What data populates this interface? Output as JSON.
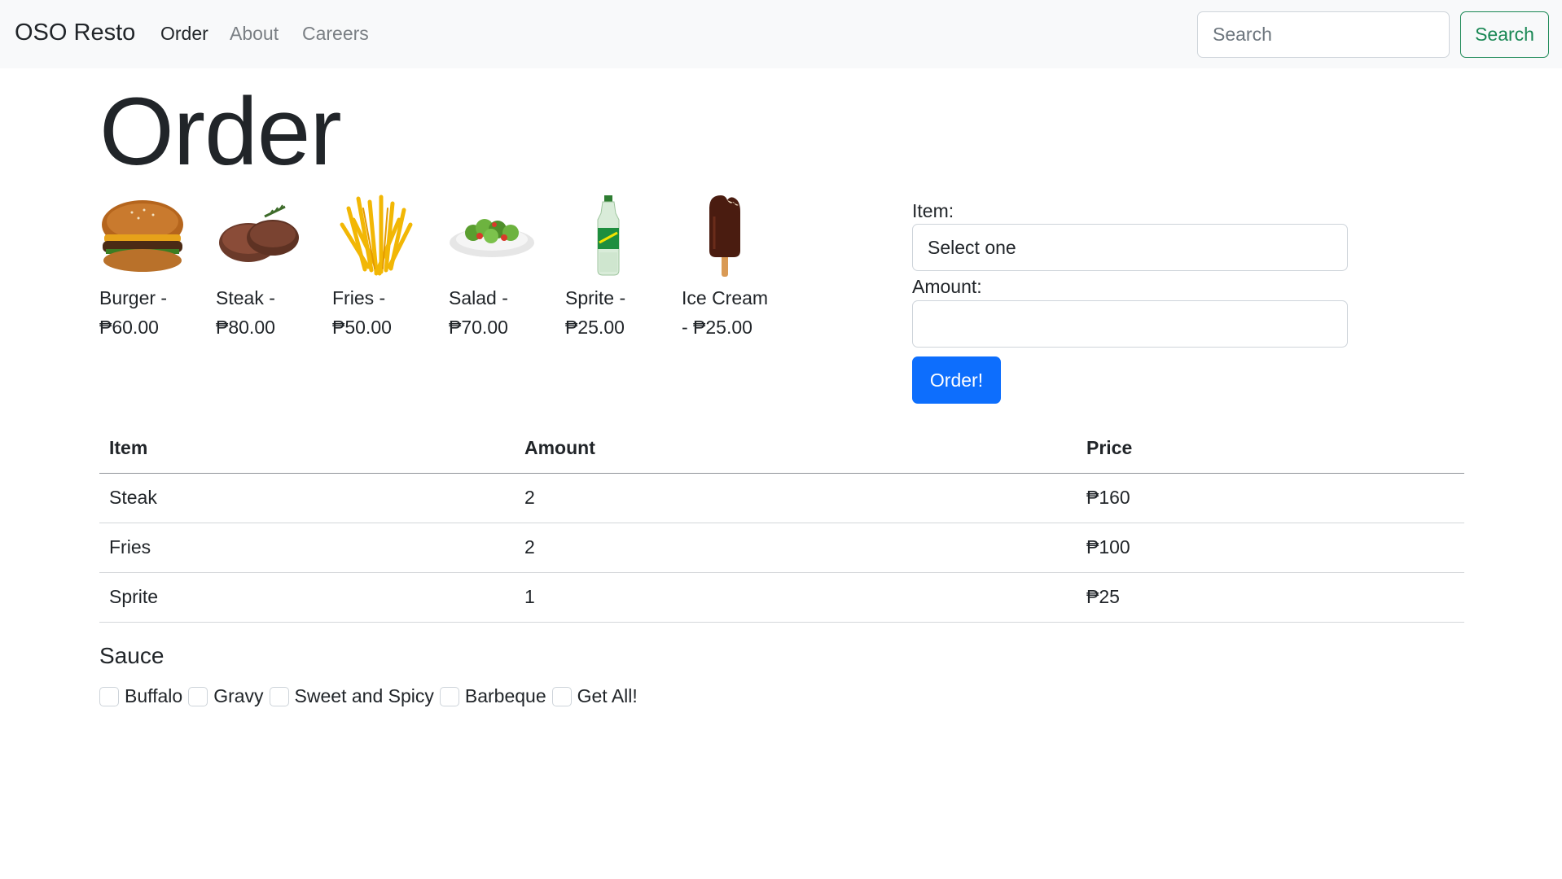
{
  "navbar": {
    "brand": "OSO Resto",
    "links": [
      {
        "label": "Order"
      },
      {
        "label": "About"
      },
      {
        "label": "Careers"
      }
    ],
    "search_placeholder": "Search",
    "search_button": "Search"
  },
  "page_title": "Order",
  "menu": [
    {
      "name": "Burger -",
      "price": "₱60.00",
      "icon": "burger-image"
    },
    {
      "name": "Steak -",
      "price": "₱80.00",
      "icon": "steak-image"
    },
    {
      "name": "Fries -",
      "price": "₱50.00",
      "icon": "fries-image"
    },
    {
      "name": "Salad -",
      "price": "₱70.00",
      "icon": "salad-image"
    },
    {
      "name": "Sprite -",
      "price": "₱25.00",
      "icon": "sprite-bottle-image"
    },
    {
      "name": "Ice Cream",
      "price": "- ₱25.00",
      "icon": "ice-cream-image"
    }
  ],
  "form": {
    "item_label": "Item:",
    "item_select_value": "Select one",
    "amount_label": "Amount:",
    "amount_value": "",
    "submit_label": "Order!"
  },
  "table": {
    "headers": [
      "Item",
      "Amount",
      "Price"
    ],
    "rows": [
      [
        "Steak",
        "2",
        "₱160"
      ],
      [
        "Fries",
        "2",
        "₱100"
      ],
      [
        "Sprite",
        "1",
        "₱25"
      ]
    ]
  },
  "sauce": {
    "title": "Sauce",
    "options": [
      {
        "label": "Buffalo",
        "checked": false
      },
      {
        "label": "Gravy",
        "checked": false
      },
      {
        "label": "Sweet and Spicy",
        "checked": false
      },
      {
        "label": "Barbeque",
        "checked": false
      },
      {
        "label": "Get All!",
        "checked": false
      }
    ]
  }
}
